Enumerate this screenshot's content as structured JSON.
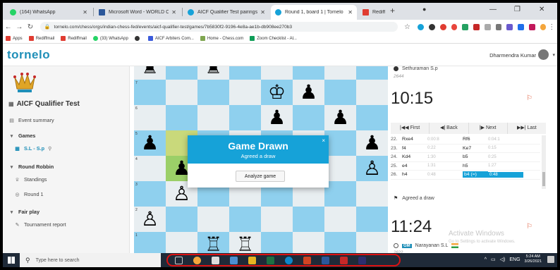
{
  "browser": {
    "tabs": [
      {
        "label": "(164) WhatsApp",
        "color": "#25d366",
        "active": false
      },
      {
        "label": "Microsoft Word - WORLD C...",
        "color": "#2b579a",
        "active": false
      },
      {
        "label": "AICF Qualifier Test pairings ...",
        "color": "#16a2d8",
        "active": false
      },
      {
        "label": "Round 1, board 1 | Tornelo",
        "color": "#16a2d8",
        "active": true
      },
      {
        "label": "Rediffmail",
        "color": "#e03c31",
        "active": false
      }
    ],
    "new_tab": "+",
    "url": "tornelo.com/chess/orgs/indian-chess-fed/events/aicf-qualifier-test/games/7b5830f2-9196-4e8a-ae1b-db908ee270b3",
    "bookmarks": [
      "Apps",
      "Rediffmail",
      "Rediffmail",
      "(33) WhatsApp",
      "AICF Arbiters Com...",
      "Home - Chess.com",
      "Zoom Checklist - Al..."
    ]
  },
  "site": {
    "logo": "tornelo",
    "user_name": "Dharmendra Kumar"
  },
  "sidebar": {
    "event_title": "AICF Qualifier Test",
    "items": [
      {
        "label": "Event summary",
        "icon": "list-icon"
      },
      {
        "label": "Games",
        "icon": "caret-down-icon"
      },
      {
        "label": "S.L - S.p",
        "icon": "game-icon"
      },
      {
        "label": "Round Robbin",
        "icon": "caret-down-icon"
      },
      {
        "label": "Standings",
        "icon": "trophy-icon"
      },
      {
        "label": "Round 1",
        "icon": "round-icon"
      },
      {
        "label": "Fair play",
        "icon": "caret-down-icon"
      },
      {
        "label": "Tournament report",
        "icon": "report-icon"
      }
    ]
  },
  "board": {
    "ranks": [
      "7",
      "6",
      "5",
      "4",
      "3",
      "2",
      "1"
    ]
  },
  "modal": {
    "title": "Game Drawn",
    "subtitle": "Agreed a draw",
    "close": "×",
    "button": "Analyze game"
  },
  "panel": {
    "top_player": "Sethuraman S.p",
    "top_rating": "2644",
    "top_clock": "10:15",
    "nav": [
      "|◀◀ First",
      "◀| Back",
      "|▶ Next",
      "▶▶| Last"
    ],
    "moves": [
      {
        "n": "22.",
        "w": "Rxe4",
        "wt": "0:00:8",
        "b": "Rf6",
        "bt": "0:04:1"
      },
      {
        "n": "23.",
        "w": "f4",
        "wt": "0:22",
        "b": "Ke7",
        "bt": "0:15"
      },
      {
        "n": "24.",
        "w": "Kd4",
        "wt": "1:30",
        "b": "b5",
        "bt": "0:25"
      },
      {
        "n": "25.",
        "w": "e4",
        "wt": "1:31",
        "b": "h5",
        "bt": "1:27"
      },
      {
        "n": "26.",
        "w": "h4",
        "wt": "0:48",
        "b": "b4 (=)",
        "bt": "0:48"
      }
    ],
    "result": "Agreed a draw",
    "bottom_clock": "11:24",
    "watermark_title": "Activate Windows",
    "watermark_sub": "Go to Settings to activate Windows.",
    "bottom_title": "GM",
    "bottom_player": "Narayanan S.L",
    "bottom_rating": "2622"
  },
  "taskbar": {
    "search_placeholder": "Type here to search",
    "language": "ENG",
    "time": "5:24 AM",
    "date": "3/26/2021"
  }
}
